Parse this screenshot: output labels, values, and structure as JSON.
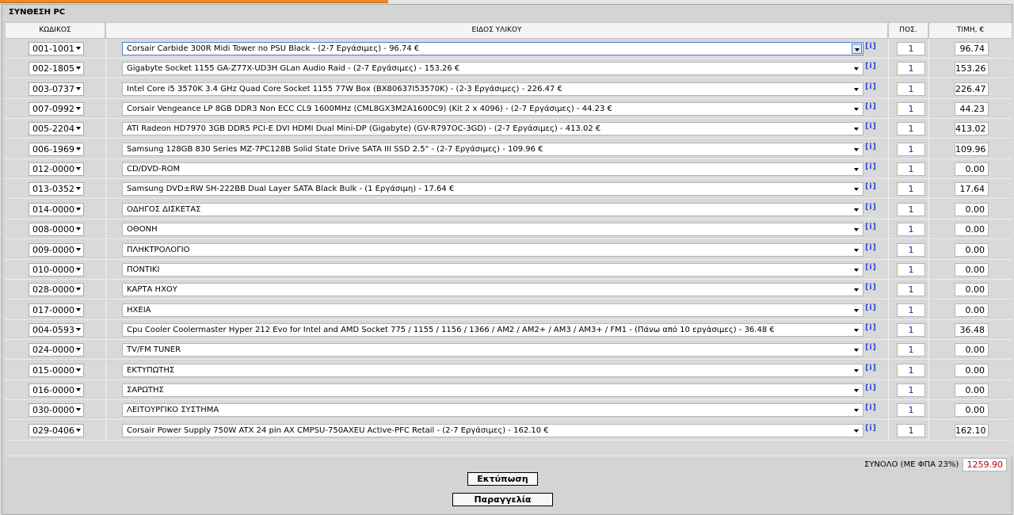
{
  "panel": {
    "title": "ΣΥΝΘΕΣΗ PC"
  },
  "headers": {
    "code": "ΚΩΔΙΚΟΣ",
    "description": "ΕΙΔΟΣ ΥΛΙΚΟΥ",
    "quantity": "ΠΟΣ.",
    "price": "ΤΙΜΗ, €"
  },
  "icons": {
    "info": "i"
  },
  "rows": [
    {
      "code": "001-1001",
      "description": "Corsair Carbide 300R Midi Tower no PSU Black - (2-7 Εργάσιμες) - 96.74 €",
      "qty": "1",
      "price": "96.74"
    },
    {
      "code": "002-1805",
      "description": "Gigabyte Socket 1155 GA-Z77X-UD3H GLan Audio Raid - (2-7 Εργάσιμες) - 153.26 €",
      "qty": "1",
      "price": "153.26"
    },
    {
      "code": "003-0737",
      "description": "Intel Core i5 3570K 3.4 GHz Quad Core Socket 1155 77W Box (BX80637I53570K) - (2-3 Εργάσιμες) - 226.47 €",
      "qty": "1",
      "price": "226.47"
    },
    {
      "code": "007-0992",
      "description": "Corsair Vengeance LP 8GB DDR3 Non ECC CL9 1600MHz (CML8GX3M2A1600C9) (Kit 2 x 4096) - (2-7 Εργάσιμες) - 44.23 €",
      "qty": "1",
      "price": "44.23"
    },
    {
      "code": "005-2204",
      "description": "ATI Radeon HD7970 3GB DDR5 PCI-E DVI HDMI Dual Mini-DP (Gigabyte) (GV-R797OC-3GD) - (2-7 Εργάσιμες) - 413.02 €",
      "qty": "1",
      "price": "413.02"
    },
    {
      "code": "006-1969",
      "description": "Samsung 128GB 830 Series MZ-7PC128B Solid State Drive SATA III SSD 2.5\" - (2-7 Εργάσιμες) - 109.96 €",
      "qty": "1",
      "price": "109.96"
    },
    {
      "code": "012-0000",
      "description": "CD/DVD-ROM",
      "qty": "1",
      "price": "0.00"
    },
    {
      "code": "013-0352",
      "description": "Samsung DVD±RW SH-222BB Dual Layer SATA Black Bulk - (1 Εργάσιμη) - 17.64 €",
      "qty": "1",
      "price": "17.64"
    },
    {
      "code": "014-0000",
      "description": "ΟΔΗΓΟΣ ΔΙΣΚΕΤΑΣ",
      "qty": "1",
      "price": "0.00"
    },
    {
      "code": "008-0000",
      "description": "ΟΘΟΝΗ",
      "qty": "1",
      "price": "0.00"
    },
    {
      "code": "009-0000",
      "description": "ΠΛΗΚΤΡΟΛΟΓΙΟ",
      "qty": "1",
      "price": "0.00"
    },
    {
      "code": "010-0000",
      "description": "ΠΟΝΤΙΚΙ",
      "qty": "1",
      "price": "0.00"
    },
    {
      "code": "028-0000",
      "description": "ΚΑΡΤΑ ΗΧΟΥ",
      "qty": "1",
      "price": "0.00"
    },
    {
      "code": "017-0000",
      "description": "ΗΧΕΙΑ",
      "qty": "1",
      "price": "0.00"
    },
    {
      "code": "004-0593",
      "description": "Cpu Cooler Coolermaster Hyper 212 Evo for Intel and AMD Socket 775 / 1155 / 1156 / 1366 / AM2 / AM2+ / AM3 / AM3+ / FM1 - (Πάνω από 10 εργάσιμες) - 36.48 €",
      "qty": "1",
      "price": "36.48"
    },
    {
      "code": "024-0000",
      "description": "TV/FM TUNER",
      "qty": "1",
      "price": "0.00"
    },
    {
      "code": "015-0000",
      "description": "ΕΚΤΥΠΩΤΗΣ",
      "qty": "1",
      "price": "0.00"
    },
    {
      "code": "016-0000",
      "description": "ΣΑΡΩΤΗΣ",
      "qty": "1",
      "price": "0.00"
    },
    {
      "code": "030-0000",
      "description": "ΛΕΙΤΟΥΡΓΙΚΟ ΣΥΣΤΗΜΑ",
      "qty": "1",
      "price": "0.00"
    },
    {
      "code": "029-0406",
      "description": "Corsair Power Supply 750W ATX 24 pin AX CMPSU-750AXEU Active-PFC Retail - (2-7 Εργάσιμες) - 162.10 €",
      "qty": "1",
      "price": "162.10"
    }
  ],
  "total": {
    "label": "ΣΥΝΟΛΟ (ΜΕ ΦΠΑ 23%)",
    "value": "1259.90"
  },
  "buttons": {
    "print": "Εκτύπωση",
    "order": "Παραγγελία"
  },
  "colors": {
    "accent_tab": "#f08a24",
    "total_value": "#c40000",
    "info_link": "#2b4fd6"
  }
}
